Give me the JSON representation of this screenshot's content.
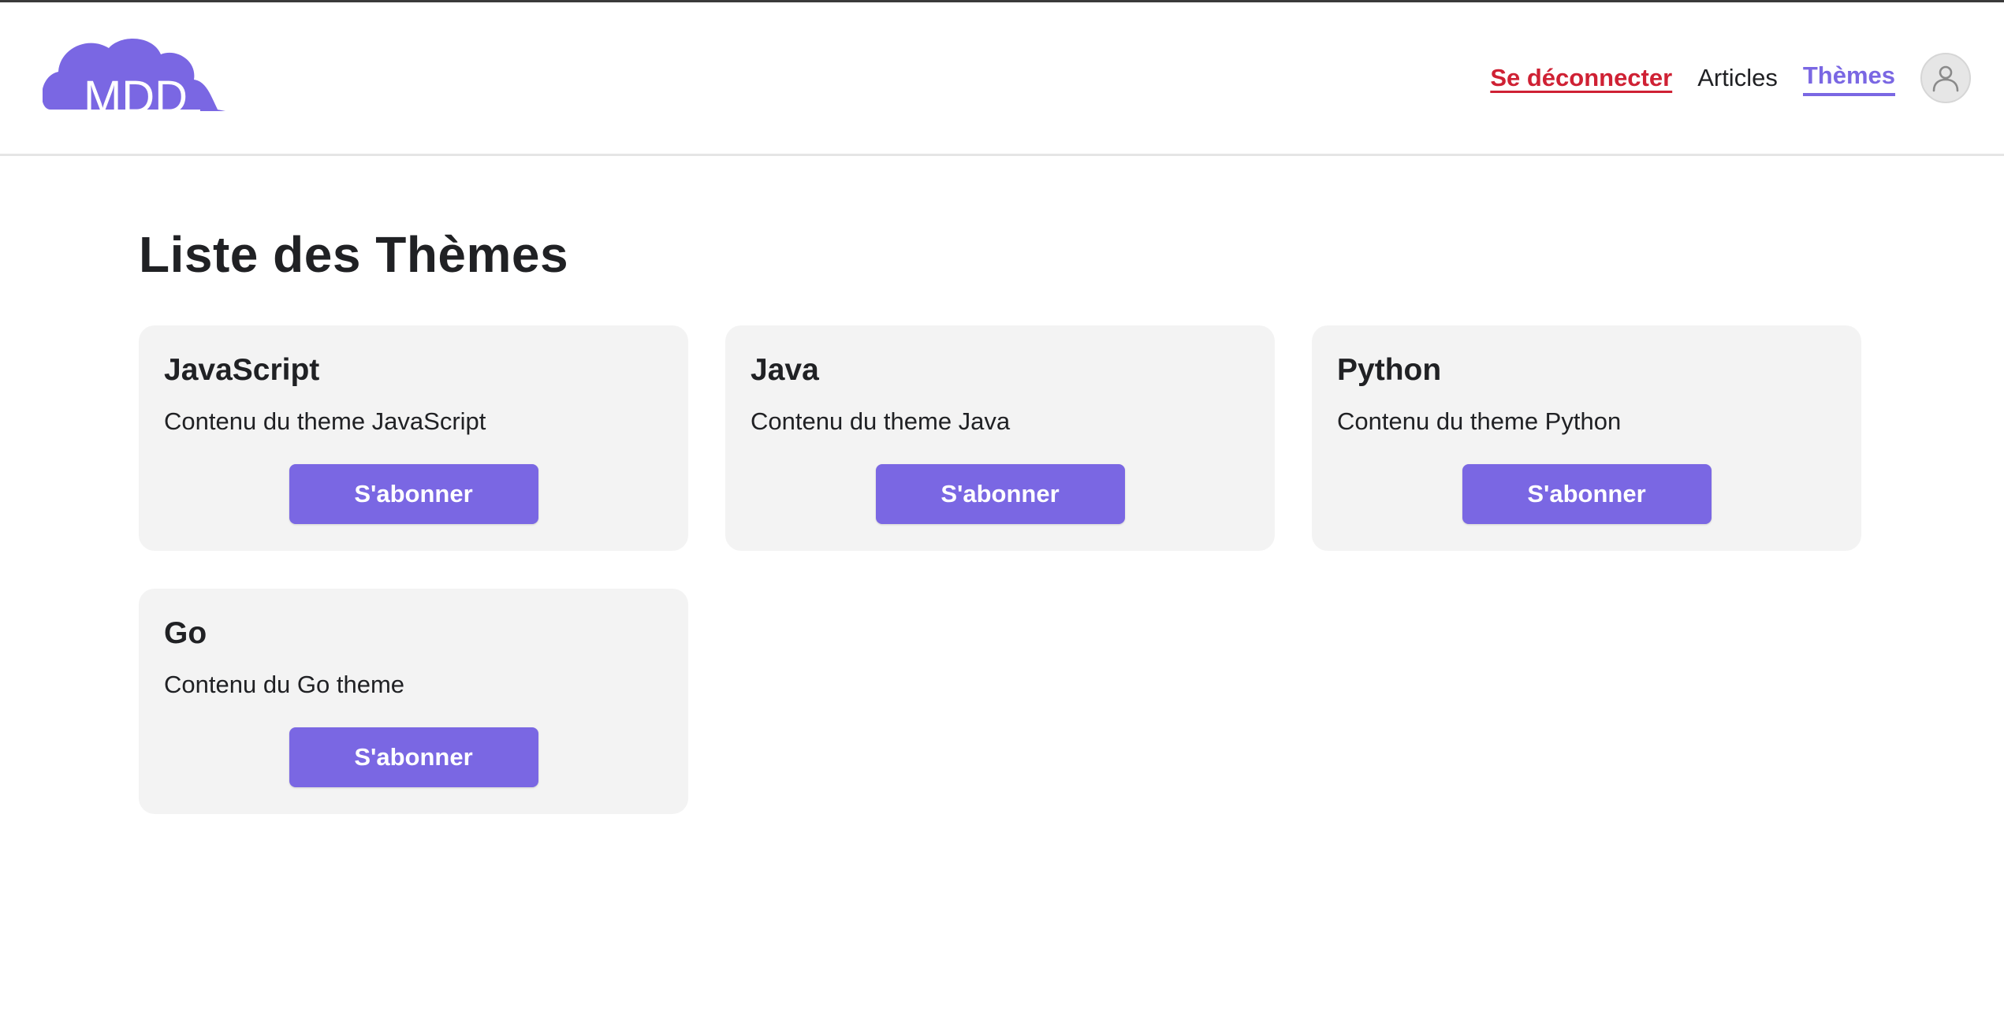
{
  "brand": {
    "logo_text": "MDD",
    "accent_color": "#7a67e3",
    "logout_color": "#cf2134"
  },
  "nav": {
    "logout_label": "Se déconnecter",
    "articles_label": "Articles",
    "themes_label": "Thèmes",
    "active_item": "Thèmes",
    "profile_icon": "user-icon"
  },
  "page": {
    "title": "Liste des Thèmes"
  },
  "themes": [
    {
      "title": "JavaScript",
      "content": "Contenu du theme JavaScript",
      "button_label": "S'abonner"
    },
    {
      "title": "Java",
      "content": "Contenu du theme Java",
      "button_label": "S'abonner"
    },
    {
      "title": "Python",
      "content": "Contenu du theme Python",
      "button_label": "S'abonner"
    },
    {
      "title": "Go",
      "content": "Contenu du Go theme",
      "button_label": "S'abonner"
    }
  ]
}
